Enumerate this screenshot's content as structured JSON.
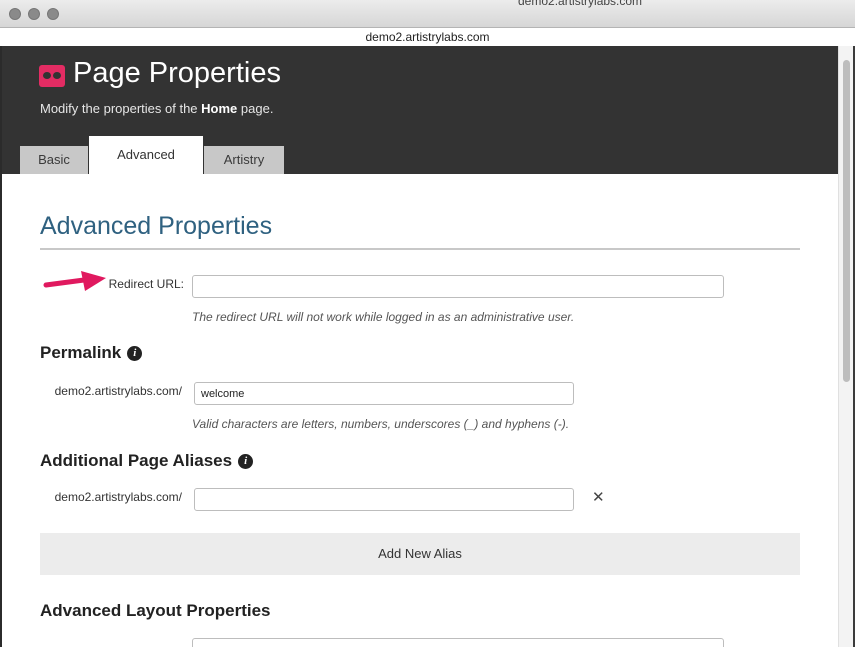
{
  "browser": {
    "background_tab_title": "demo2.artistrylabs.com",
    "url": "demo2.artistrylabs.com"
  },
  "header": {
    "title": "Page Properties",
    "subtitle_prefix": "Modify the properties of the ",
    "subtitle_page": "Home",
    "subtitle_suffix": " page.",
    "logo_icon": "artistry-logo-icon",
    "accent_color": "#e32c63",
    "bg_color": "#333333"
  },
  "tabs": [
    {
      "label": "Basic"
    },
    {
      "label": "Advanced",
      "active": true
    },
    {
      "label": "Artistry"
    }
  ],
  "advanced": {
    "heading": "Advanced Properties",
    "heading_color": "#2f6180",
    "redirect": {
      "label": "Redirect URL:",
      "value": "",
      "hint": "The redirect URL will not work while logged in as an administrative user."
    },
    "permalink": {
      "heading": "Permalink",
      "info_icon": "info-icon",
      "prefix": "demo2.artistrylabs.com/",
      "value": "welcome",
      "hint": "Valid characters are letters, numbers, underscores (_) and hyphens (-)."
    },
    "aliases": {
      "heading": "Additional Page Aliases",
      "info_icon": "info-icon",
      "prefix": "demo2.artistrylabs.com/",
      "value": "",
      "remove_icon": "close-icon",
      "remove_glyph": "✕",
      "add_label": "Add New Alias"
    },
    "layout": {
      "heading": "Advanced Layout Properties"
    }
  },
  "annotation": {
    "arrow_color": "#e0195f"
  }
}
